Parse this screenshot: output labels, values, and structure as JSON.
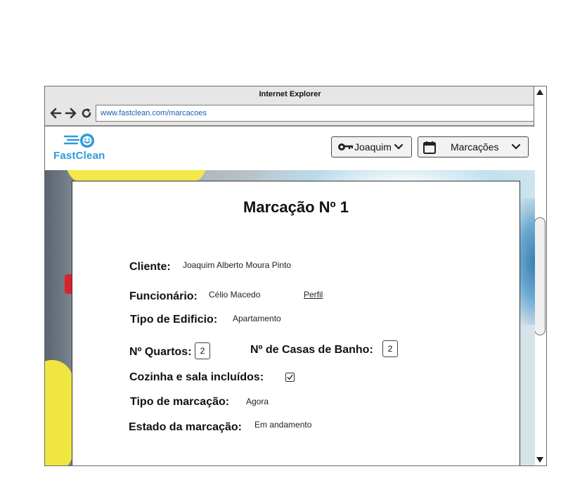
{
  "browser": {
    "title": "Internet Explorer",
    "url": "www.fastclean.com/marcacoes"
  },
  "header": {
    "logo_text": "FastClean",
    "user_label": "Joaquim",
    "menu_label": "Marcações"
  },
  "booking": {
    "title": "Marcação Nº 1",
    "client_label": "Cliente:",
    "client_value": "Joaquim Alberto Moura Pinto",
    "employee_label": "Funcionário:",
    "employee_value": "Célio Macedo",
    "profile_link": "Perfil",
    "building_label": "Tipo de Edificio:",
    "building_value": "Apartamento",
    "rooms_label": "Nº Quartos:",
    "rooms_value": "2",
    "bathrooms_label": "Nº de Casas de Banho:",
    "bathrooms_value": "2",
    "kitchen_label": "Cozinha e sala incluídos:",
    "kitchen_included": true,
    "type_label": "Tipo de marcação:",
    "type_value": "Agora",
    "status_label": "Estado da marcação:",
    "status_value": "Em andamento"
  },
  "colors": {
    "brand": "#2d9bdb",
    "link": "#1a5fb4"
  }
}
